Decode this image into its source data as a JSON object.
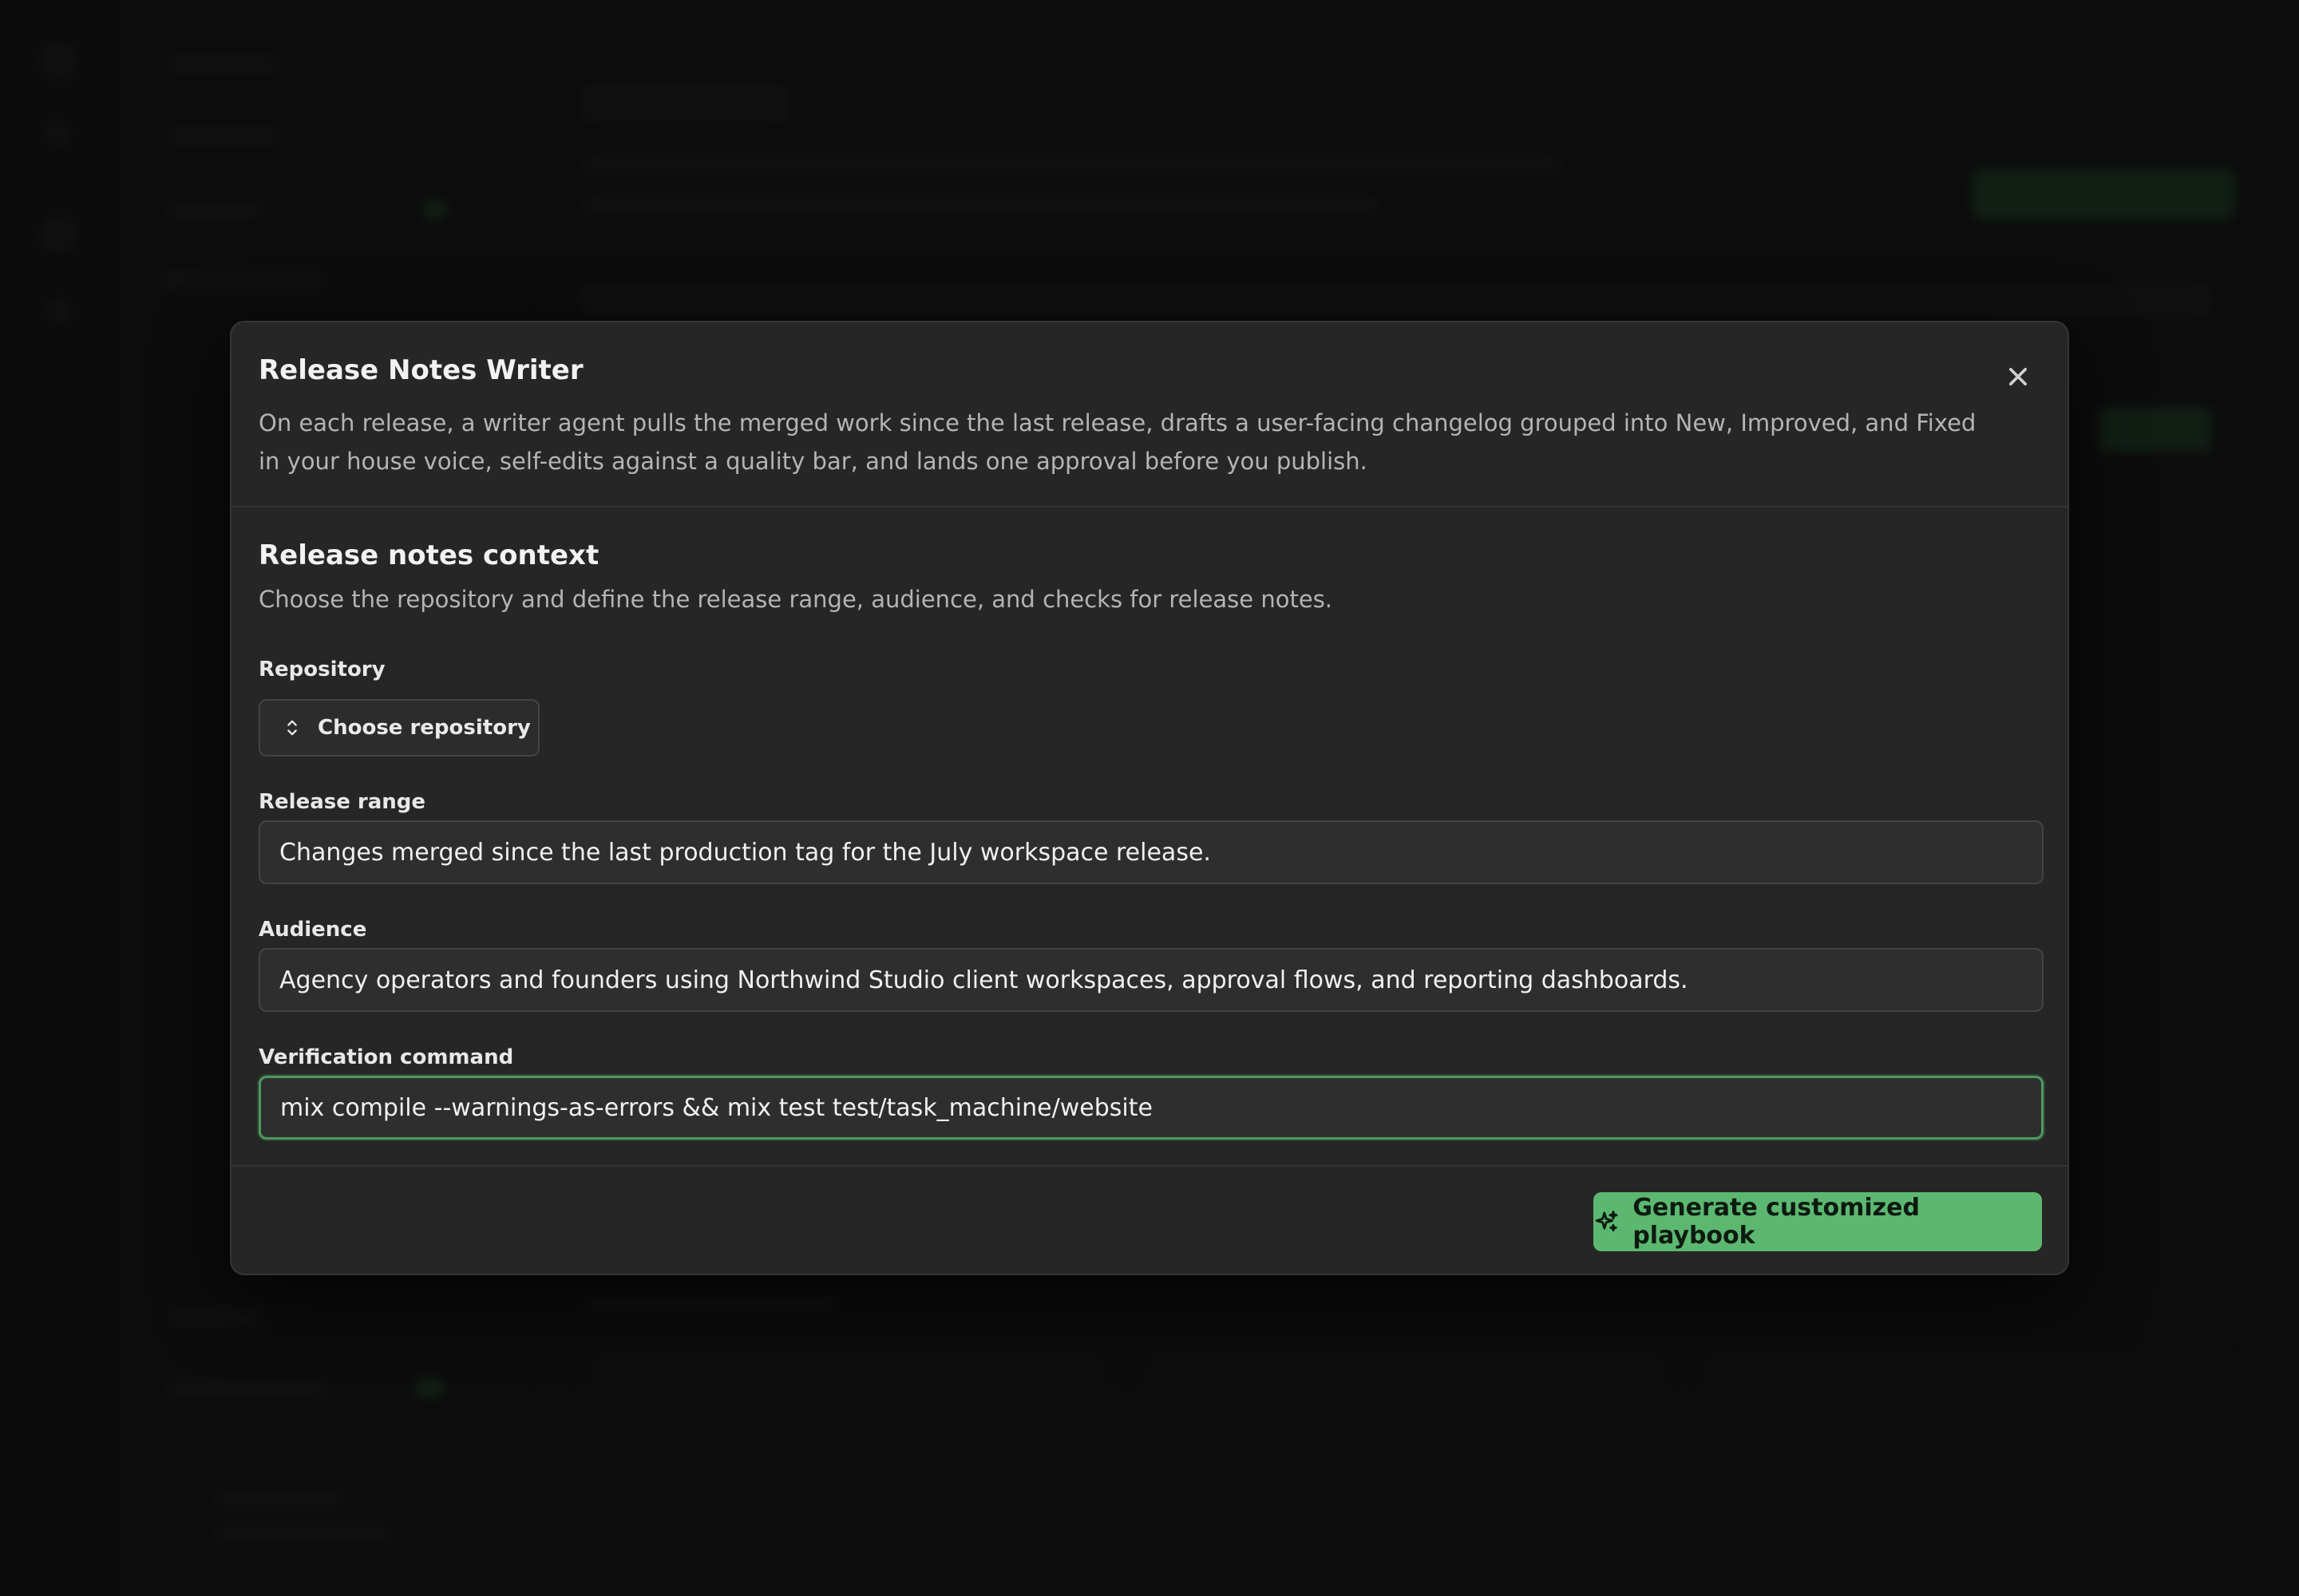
{
  "modal": {
    "title": "Release Notes Writer",
    "description": "On each release, a writer agent pulls the merged work since the last release, drafts a user-facing changelog grouped into New, Improved, and Fixed in your house voice, self-edits against a quality bar, and lands one approval before you publish.",
    "close_icon": "close-icon"
  },
  "section": {
    "title": "Release notes context",
    "description": "Choose the repository and define the release range, audience, and checks for release notes."
  },
  "fields": {
    "repository": {
      "label": "Repository",
      "button_label": "Choose repository",
      "icon": "chevron-up-down-icon"
    },
    "release_range": {
      "label": "Release range",
      "value": "Changes merged since the last production tag for the July workspace release."
    },
    "audience": {
      "label": "Audience",
      "value": "Agency operators and founders using Northwind Studio client workspaces, approval flows, and reporting dashboards."
    },
    "verification_command": {
      "label": "Verification command",
      "value": "mix compile --warnings-as-errors && mix test test/task_machine/website"
    }
  },
  "footer": {
    "generate_label": "Generate customized playbook",
    "generate_icon": "sparkles-icon"
  },
  "colors": {
    "accent": "#5cb870",
    "focus_ring": "#4c9a5c",
    "modal_bg": "#262626",
    "backdrop": "#141414"
  }
}
